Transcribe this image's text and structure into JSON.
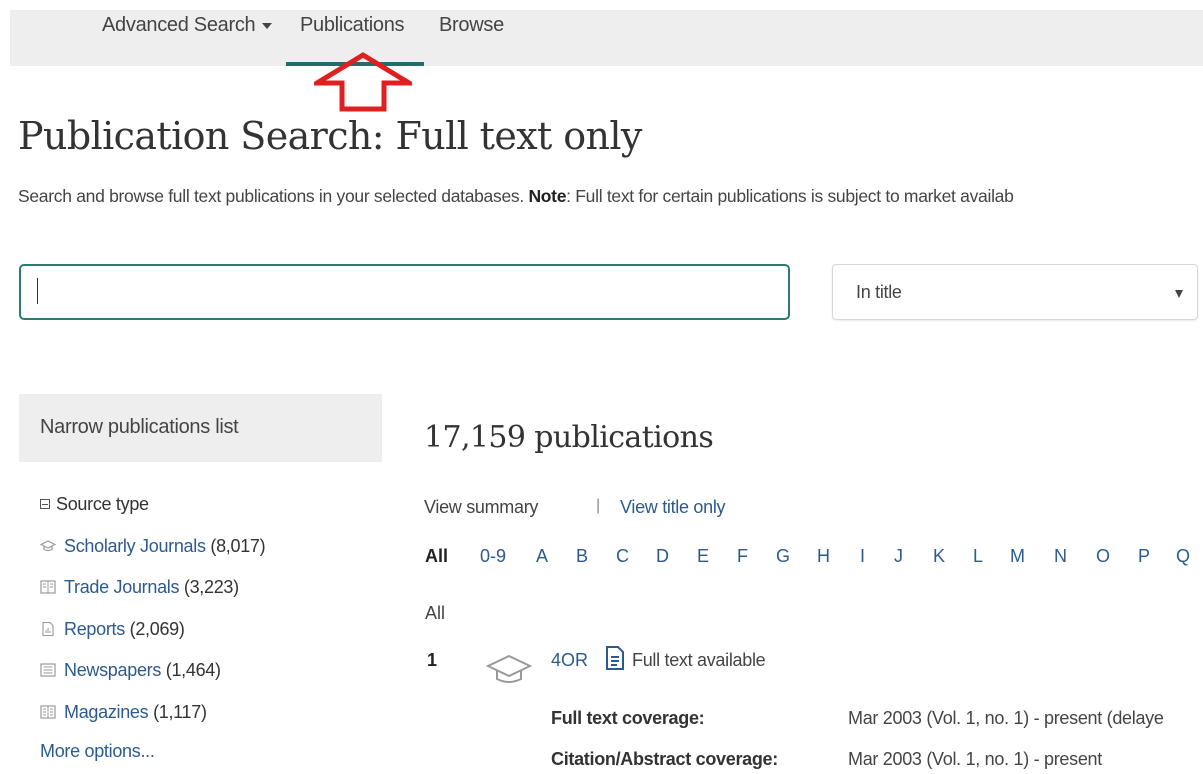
{
  "nav": {
    "items": [
      {
        "label": "Advanced Search",
        "has_caret": true
      },
      {
        "label": "Publications",
        "active": true
      },
      {
        "label": "Browse"
      }
    ]
  },
  "annotation": {
    "arrow_color": "#e02020",
    "icon": "up-arrow-icon"
  },
  "page": {
    "title": "Publication Search: Full text only",
    "subtitle_start": "Search and browse full text publications in your selected databases. ",
    "subtitle_note_label": "Note",
    "subtitle_note_text": ": Full text for certain publications is subject to market availab"
  },
  "search": {
    "value": "",
    "scope_selected": "In title"
  },
  "sidebar": {
    "header": "Narrow publications list",
    "facet_title": "Source type",
    "items": [
      {
        "label": "Scholarly Journals",
        "count": "(8,017)",
        "icon": "graduation-cap-icon"
      },
      {
        "label": "Trade Journals",
        "count": "(3,223)",
        "icon": "trade-journal-icon"
      },
      {
        "label": "Reports",
        "count": "(2,069)",
        "icon": "report-icon"
      },
      {
        "label": "Newspapers",
        "count": "(1,464)",
        "icon": "newspaper-icon"
      },
      {
        "label": "Magazines",
        "count": "(1,117)",
        "icon": "magazine-icon"
      }
    ],
    "more_options": "More options..."
  },
  "results": {
    "count_label": "17,159 publications",
    "view_summary": "View summary",
    "separator": "|",
    "view_title_only": "View title only",
    "alphabet": [
      "All",
      "0-9",
      "A",
      "B",
      "C",
      "D",
      "E",
      "F",
      "G",
      "H",
      "I",
      "J",
      "K",
      "L",
      "M",
      "N",
      "O",
      "P",
      "Q"
    ],
    "section_label": "All",
    "first": {
      "number": "1",
      "title": "4OR",
      "fulltext_label": "Full text available",
      "fulltext_coverage_label": "Full text coverage:",
      "fulltext_coverage_value": "Mar 2003 (Vol. 1, no. 1) - present (delaye",
      "citation_coverage_label": "Citation/Abstract coverage:",
      "citation_coverage_value": "Mar 2003 (Vol. 1, no. 1) - present"
    }
  },
  "colors": {
    "accent": "#1f6e6b",
    "link": "#2c5a8e",
    "nav_bg": "#eeeeee"
  }
}
